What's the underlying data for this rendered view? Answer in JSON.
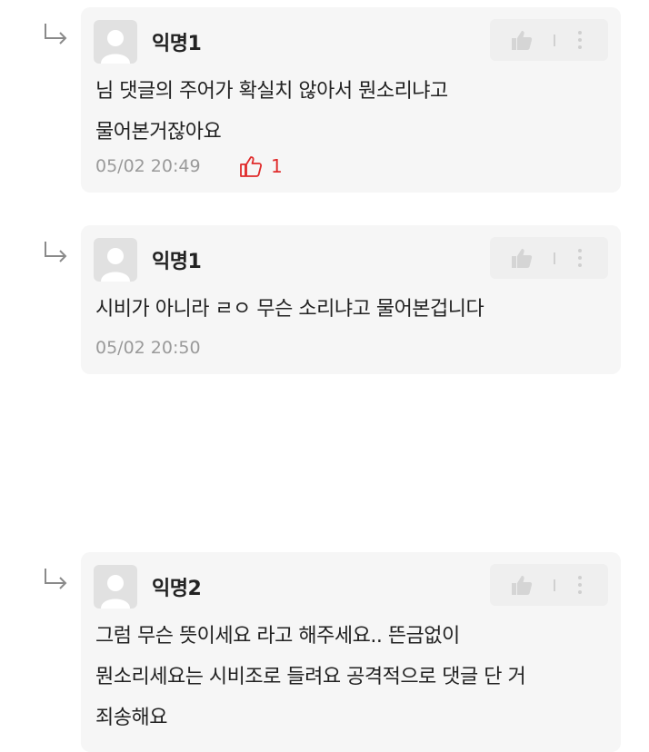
{
  "comments": [
    {
      "author": "익명1",
      "lines": [
        "님 댓글의 주어가 확실치 않아서 뭔소리냐고",
        "물어본거잖아요"
      ],
      "time": "05/02 20:49",
      "likes": "1"
    },
    {
      "author": "익명1",
      "lines": [
        "시비가 아니라 ㄹㅇ 무슨 소리냐고 물어본겁니다"
      ],
      "time": "05/02 20:50"
    },
    {
      "author": "익명2",
      "lines": [
        "그럼 무슨 뜻이세요 라고 해주세요.. 뜬금없이",
        "뭔소리세요는 시비조로 들려요 공격적으로 댓글 단 거",
        "죄송해요"
      ]
    }
  ],
  "icons": {
    "reply": "reply-arrow-icon",
    "like": "thumbs-up-icon",
    "more": "more-vertical-icon",
    "avatar": "default-avatar-icon"
  },
  "colors": {
    "card_bg": "#f6f6f6",
    "like_active": "#e02b2b",
    "meta_text": "#9a9a9a"
  }
}
